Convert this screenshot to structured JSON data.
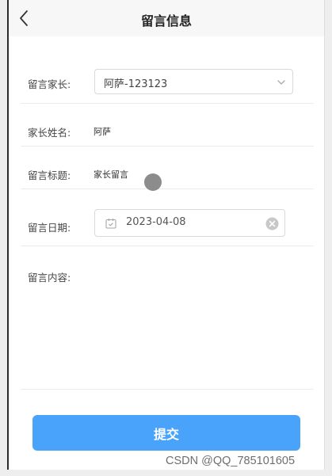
{
  "header": {
    "title": "留言信息",
    "back_icon": "chevron-left-icon"
  },
  "form": {
    "parent": {
      "label": "留言家长:",
      "value": "阿萨-123123",
      "arrow_icon": "chevron-down-icon"
    },
    "parent_name": {
      "label": "家长姓名:",
      "value": "阿萨"
    },
    "title": {
      "label": "留言标题:",
      "value": "家长留言"
    },
    "date": {
      "label": "留言日期:",
      "value": "2023-04-08",
      "calendar_icon": "calendar-icon",
      "clear_icon": "clear-icon"
    },
    "content": {
      "label": "留言内容:",
      "value": ""
    }
  },
  "submit": {
    "label": "提交",
    "color": "#4aa3fa"
  },
  "watermark": "CSDN @QQ_785101605"
}
